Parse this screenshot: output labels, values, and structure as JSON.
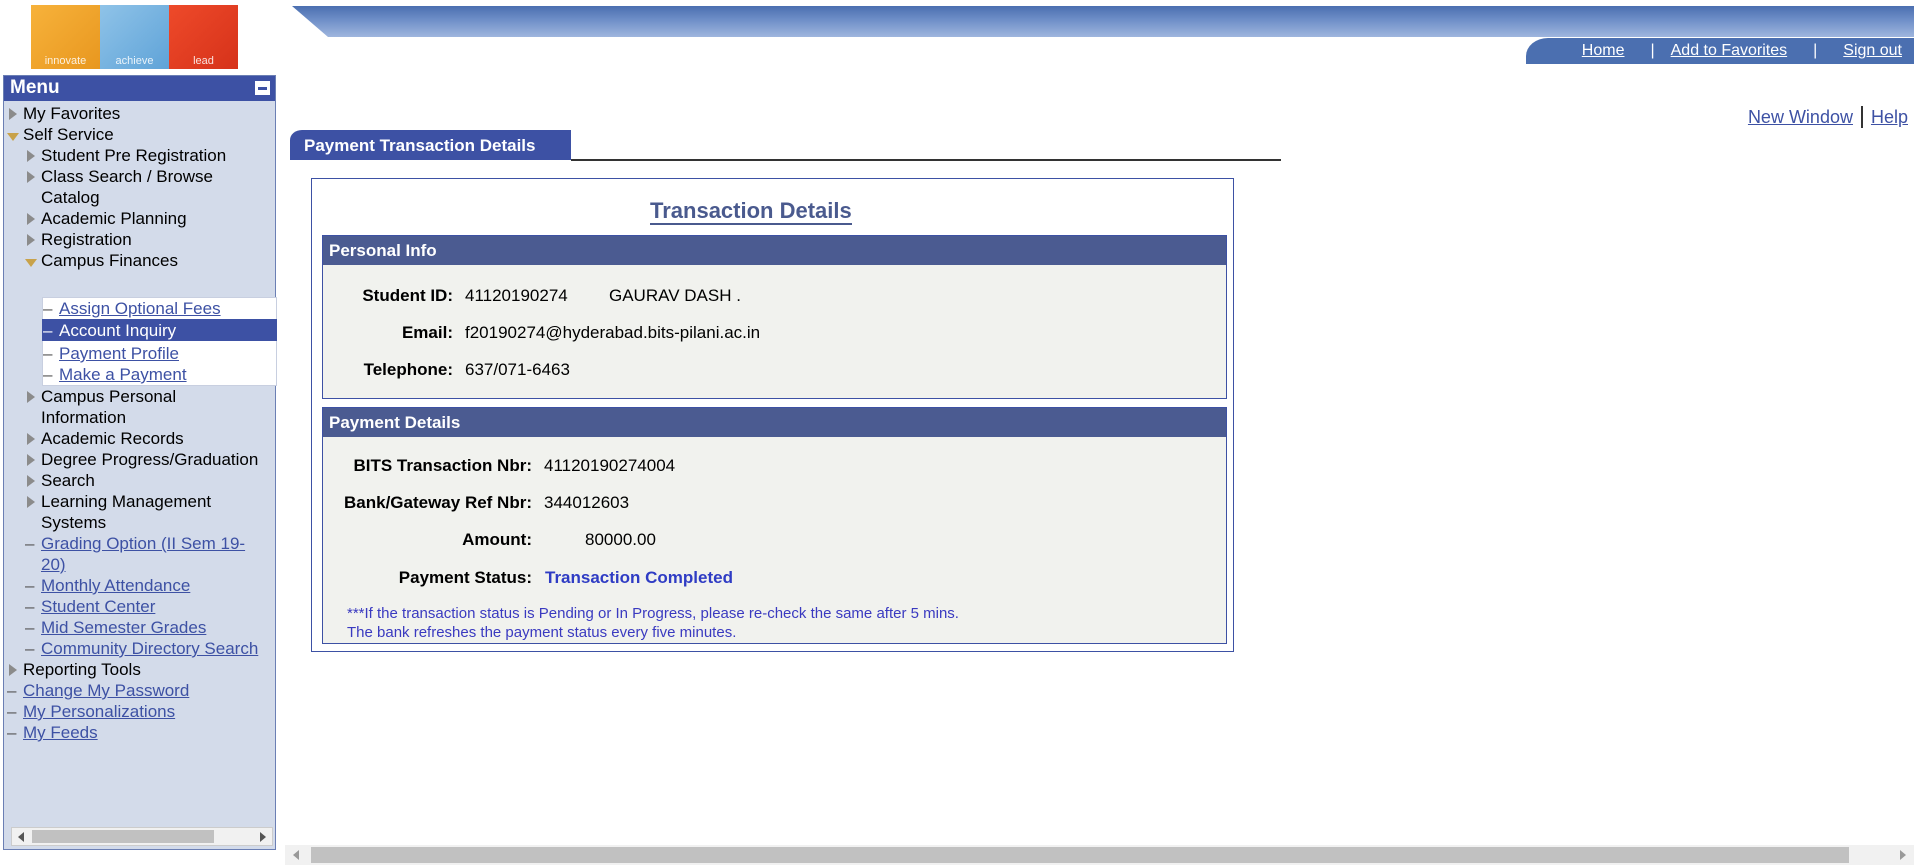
{
  "logo": {
    "words": [
      "innovate",
      "achieve",
      "lead"
    ]
  },
  "header": {
    "home": "Home",
    "add_favorites": "Add to Favorites",
    "sign_out": "Sign out",
    "separator": "|"
  },
  "page_links": {
    "new_window": "New Window",
    "help": "Help"
  },
  "menu": {
    "title": "Menu",
    "my_favorites": "My Favorites",
    "self_service": "Self Service",
    "student_pre_registration": "Student Pre Registration",
    "class_search_1": "Class Search / Browse",
    "class_search_2": "Catalog",
    "academic_planning": "Academic Planning",
    "registration": "Registration",
    "campus_finances": "Campus Finances",
    "assign_optional_fees": "Assign Optional Fees",
    "account_inquiry": "Account Inquiry",
    "payment_profile": "Payment Profile",
    "make_a_payment": "Make a Payment",
    "campus_personal_1": "Campus Personal",
    "campus_personal_2": "Information",
    "academic_records": "Academic Records",
    "degree_progress": "Degree Progress/Graduation",
    "search": "Search",
    "lms_1": "Learning Management",
    "lms_2": "Systems",
    "grading_option_1": "Grading Option (II Sem 19-",
    "grading_option_2": "20)",
    "monthly_attendance": "Monthly Attendance",
    "student_center": "Student Center",
    "mid_semester_grades": "Mid Semester Grades",
    "community_directory_search": "Community Directory Search",
    "reporting_tools": "Reporting Tools",
    "change_password": "Change My Password",
    "my_personalizations": "My Personalizations",
    "my_feeds": "My Feeds",
    "dash": "–"
  },
  "tab": {
    "label": "Payment Transaction Details"
  },
  "details": {
    "title": "Transaction Details",
    "personal_info": {
      "header": "Personal Info",
      "student_id_label": "Student ID:",
      "student_id": "41120190274",
      "student_name": "GAURAV  DASH .",
      "email_label": "Email:",
      "email": "f20190274@hyderabad.bits-pilani.ac.in",
      "telephone_label": "Telephone:",
      "telephone": "637/071-6463"
    },
    "payment_details": {
      "header": "Payment Details",
      "bits_txn_label": "BITS Transaction Nbr:",
      "bits_txn": "41120190274004",
      "bank_ref_label": "Bank/Gateway Ref Nbr:",
      "bank_ref": "344012603",
      "amount_label": "Amount:",
      "amount": "80000.00",
      "status_label": "Payment Status:",
      "status": "Transaction Completed",
      "note_1": "***If the transaction status is Pending or In Progress, please re-check the same after 5 mins.",
      "note_2": "The bank refreshes the payment status every five minutes."
    }
  },
  "colors": {
    "accent": "#3d51a4",
    "section_header": "#4b5b91",
    "panel_bg": "#f1f2ee",
    "menu_bg": "#d3dbea",
    "status_text": "#2f3cc4"
  }
}
